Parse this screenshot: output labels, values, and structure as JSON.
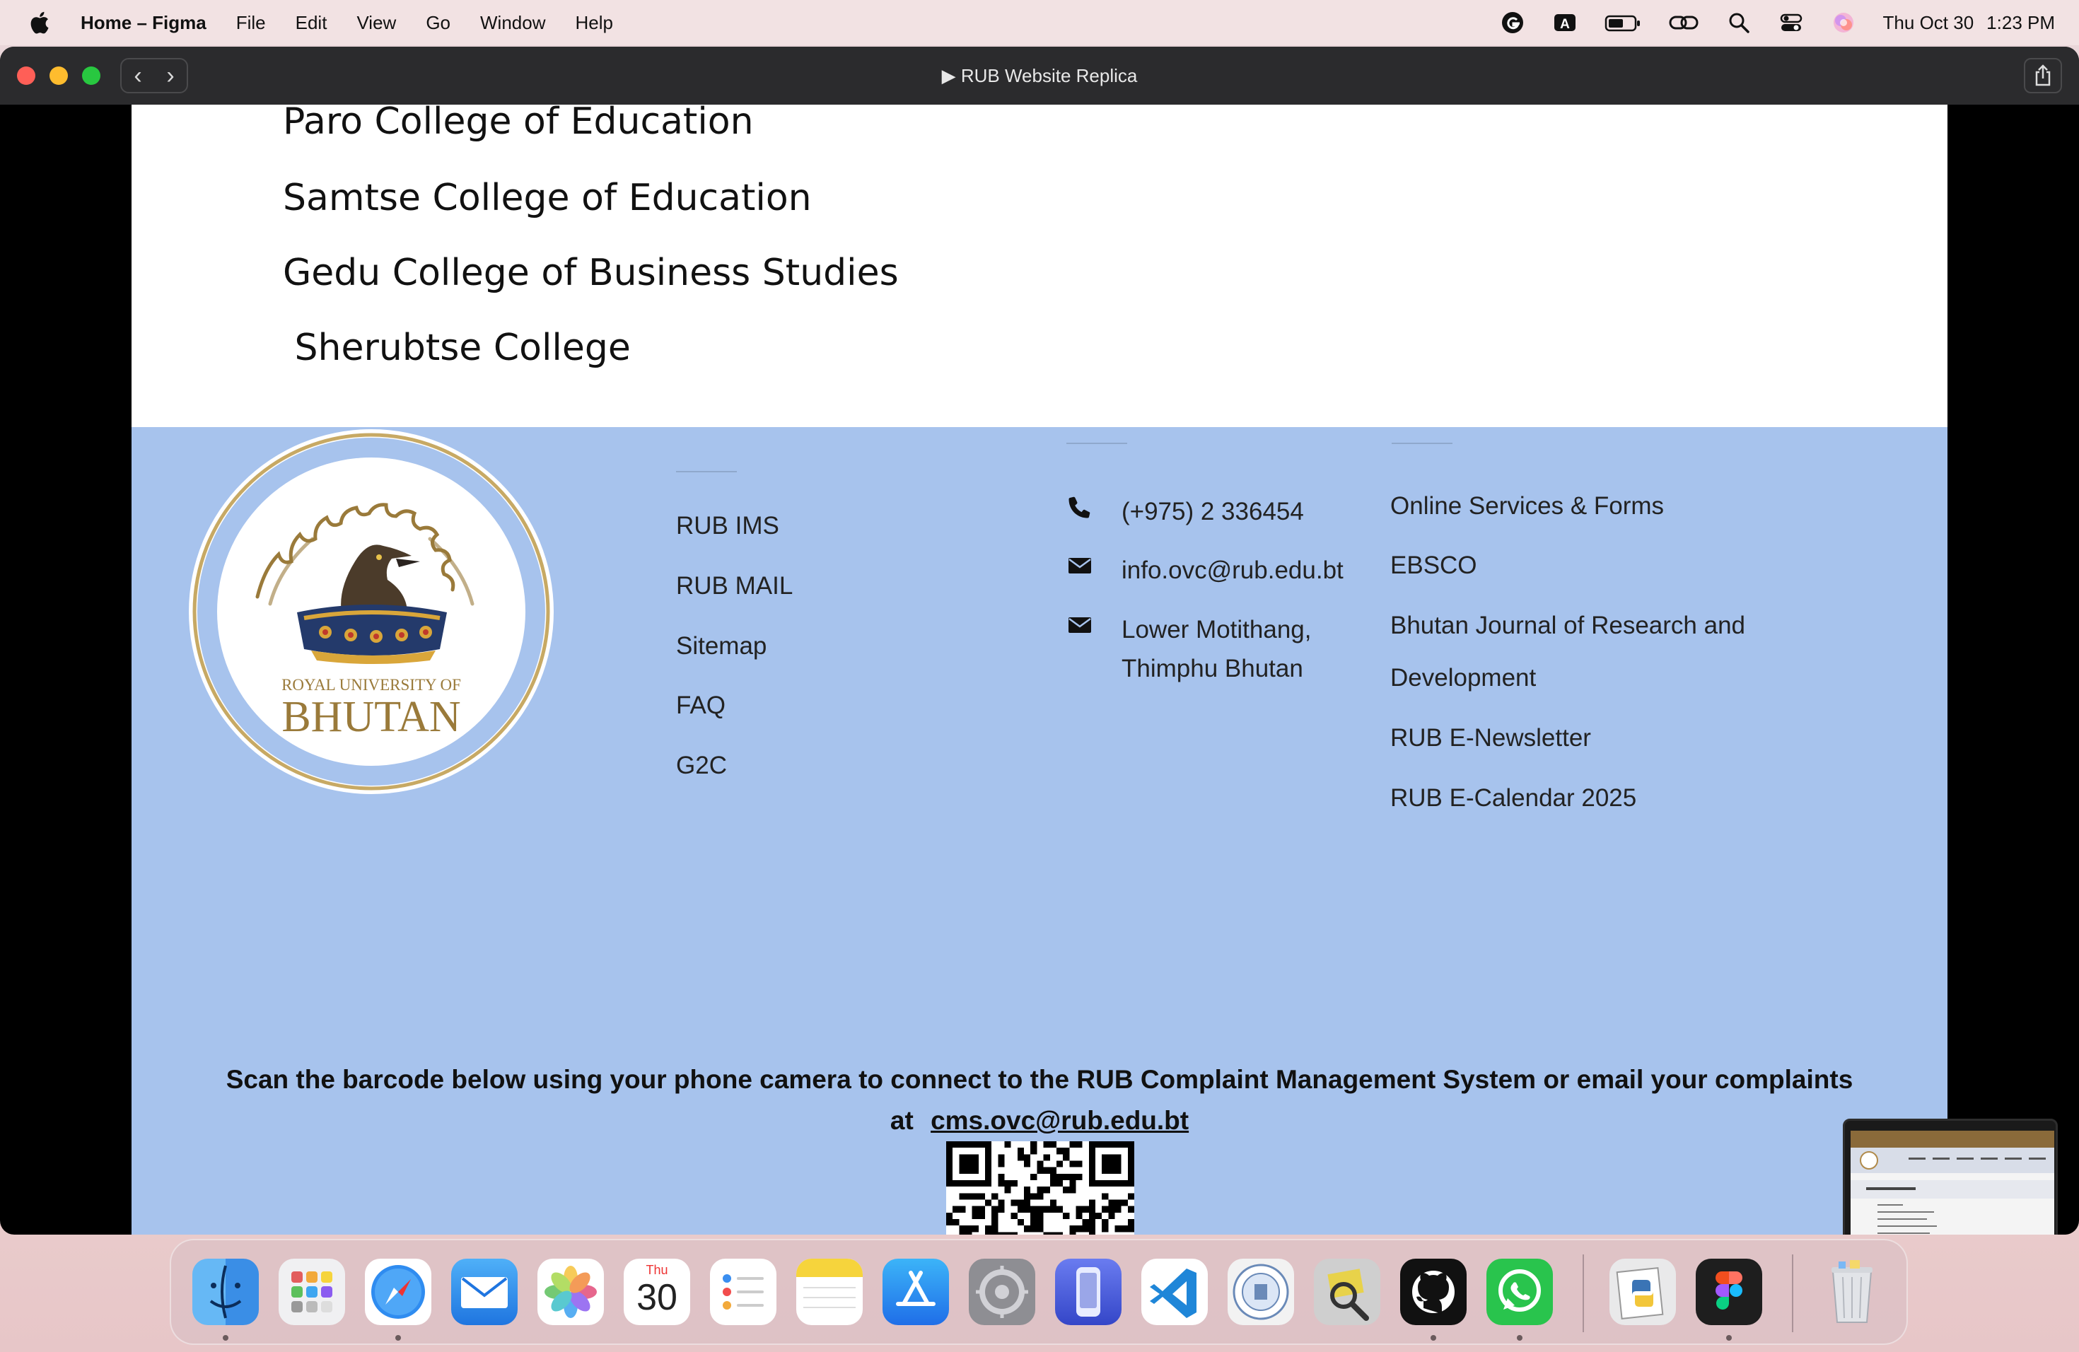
{
  "menubar": {
    "app_name": "Home – Figma",
    "menus": [
      "File",
      "Edit",
      "View",
      "Go",
      "Window",
      "Help"
    ],
    "status_icons": [
      "grammarly-icon",
      "input-a-icon",
      "battery-icon",
      "link-icon",
      "search-icon",
      "control-center-icon",
      "siri-icon"
    ],
    "keyboard_label": "A",
    "date": "Thu Oct 30",
    "time": "1:23 PM"
  },
  "window": {
    "title": "▶ RUB Website Replica",
    "nav_back": "‹",
    "nav_forward": "›"
  },
  "colleges": [
    "Paro College of Education",
    "Samtse College of Education",
    "Gedu College of Business Studies",
    " Sherubtse College"
  ],
  "footer": {
    "logo": {
      "line1": "ROYAL UNIVERSITY OF",
      "line2": "BHUTAN"
    },
    "quick_links": [
      "RUB IMS",
      "RUB MAIL",
      "Sitemap",
      "FAQ",
      "G2C"
    ],
    "contact": {
      "phone": "(+975) 2 336454",
      "email": "info.ovc@rub.edu.bt",
      "address_line1": "Lower Motithang,",
      "address_line2": "Thimphu Bhutan"
    },
    "resources": [
      "Online Services & Forms",
      "EBSCO",
      "Bhutan Journal of Research and",
      "Development",
      "RUB E-Newsletter",
      "RUB E-Calendar 2025"
    ],
    "cms_line1": "Scan the barcode below using your phone camera to connect to the RUB Complaint Management System or email your complaints",
    "cms_line2_prefix": "at",
    "cms_email": "cms.ovc@rub.edu.bt"
  },
  "dock": {
    "calendar_day": "Thu",
    "calendar_date": "30",
    "apps": [
      "finder",
      "launchpad",
      "safari",
      "mail",
      "photos",
      "calendar",
      "reminders",
      "notes",
      "app-store",
      "system-settings",
      "simulator",
      "vscode",
      "rub-app",
      "mailsteward",
      "github-desktop",
      "whatsapp",
      "python-launcher",
      "figma",
      "trash"
    ]
  },
  "colors": {
    "footer_bg": "#a7c3ed",
    "titlebar": "#2b2b2d",
    "logo_gold": "#9a7a3a"
  }
}
